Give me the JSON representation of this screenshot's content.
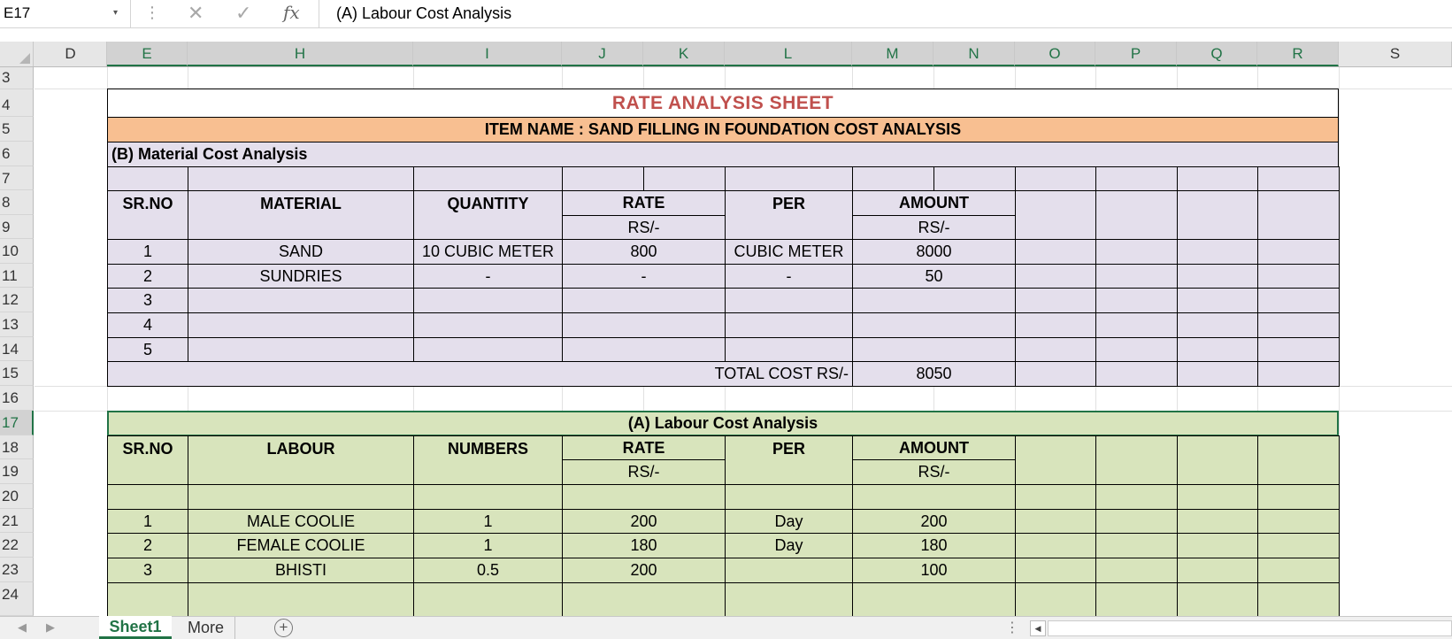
{
  "formula_bar": {
    "name_box": "E17",
    "name_box_arrow": "▾",
    "dots": "⋮",
    "cancel": "✕",
    "enter": "✓",
    "fx": "fx",
    "formula": "(A) Labour Cost Analysis"
  },
  "columns": [
    "D",
    "E",
    "H",
    "I",
    "J",
    "K",
    "L",
    "M",
    "N",
    "O",
    "P",
    "Q",
    "R",
    "S"
  ],
  "rows": [
    "3",
    "4",
    "5",
    "6",
    "7",
    "8",
    "9",
    "10",
    "11",
    "12",
    "13",
    "14",
    "15",
    "16",
    "17",
    "18",
    "19",
    "20",
    "21",
    "22",
    "23",
    "24"
  ],
  "sheet": {
    "title": "RATE ANALYSIS SHEET",
    "item_name": "ITEM NAME : SAND FILLING IN FOUNDATION COST ANALYSIS",
    "material": {
      "section_title": "(B) Material Cost Analysis",
      "headers": {
        "srno": "SR.NO",
        "material": "MATERIAL",
        "quantity": "QUANTITY",
        "rate": "RATE",
        "per": "PER",
        "amount": "AMOUNT"
      },
      "units": {
        "rate": "RS/-",
        "amount": "RS/-"
      },
      "rows": [
        {
          "srno": "1",
          "material": "SAND",
          "quantity": "10 CUBIC METER",
          "rate": "800",
          "per": "CUBIC METER",
          "amount": "8000"
        },
        {
          "srno": "2",
          "material": "SUNDRIES",
          "quantity": "-",
          "rate": "-",
          "per": "-",
          "amount": "50"
        },
        {
          "srno": "3",
          "material": "",
          "quantity": "",
          "rate": "",
          "per": "",
          "amount": ""
        },
        {
          "srno": "4",
          "material": "",
          "quantity": "",
          "rate": "",
          "per": "",
          "amount": ""
        },
        {
          "srno": "5",
          "material": "",
          "quantity": "",
          "rate": "",
          "per": "",
          "amount": ""
        }
      ],
      "total_label": "TOTAL COST RS/-",
      "total_value": "8050"
    },
    "labour": {
      "section_title": "(A) Labour Cost Analysis",
      "headers": {
        "srno": "SR.NO",
        "labour": "LABOUR",
        "numbers": "NUMBERS",
        "rate": "RATE",
        "per": "PER",
        "amount": "AMOUNT"
      },
      "units": {
        "rate": "RS/-",
        "amount": "RS/-"
      },
      "rows": [
        {
          "srno": "1",
          "labour": "MALE COOLIE",
          "numbers": "1",
          "rate": "200",
          "per": "Day",
          "amount": "200"
        },
        {
          "srno": "2",
          "labour": "FEMALE COOLIE",
          "numbers": "1",
          "rate": "180",
          "per": "Day",
          "amount": "180"
        },
        {
          "srno": "3",
          "labour": "BHISTI",
          "numbers": "0.5",
          "rate": "200",
          "per": "",
          "amount": "100"
        }
      ]
    }
  },
  "tabs": {
    "prev": "◀",
    "next": "▶",
    "active": "Sheet1",
    "more": "More",
    "add": "+",
    "dots": "⋮",
    "scroll_left": "◀"
  },
  "colors": {
    "material_fill": "#e4dfec",
    "labour_fill": "#d8e4bc",
    "item_fill": "#f8bf91",
    "title_text": "#c0504d",
    "excel_green": "#217346"
  }
}
